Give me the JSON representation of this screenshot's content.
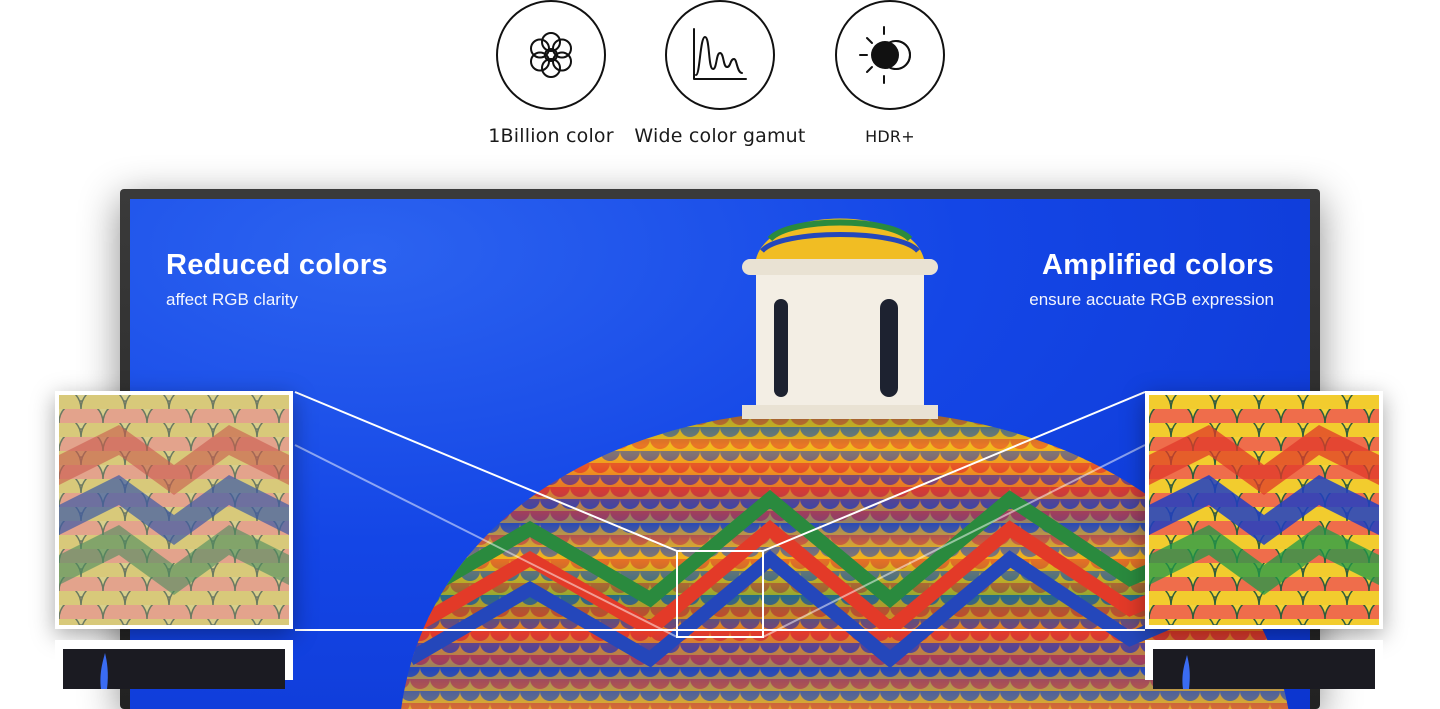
{
  "features": [
    {
      "icon": "flower-icon",
      "label": "1Billion color"
    },
    {
      "icon": "wave-graph-icon",
      "label": "Wide color gamut"
    },
    {
      "icon": "brightness-contrast-icon",
      "label": "HDR+"
    }
  ],
  "left": {
    "headline": "Reduced colors",
    "subtext": "affect RGB clarity"
  },
  "right": {
    "headline": "Amplified colors",
    "subtext": "ensure accuate RGB expression"
  },
  "colors": {
    "sky": "#1446e6",
    "frame": "#2a2a2a",
    "outline": "#111111"
  }
}
